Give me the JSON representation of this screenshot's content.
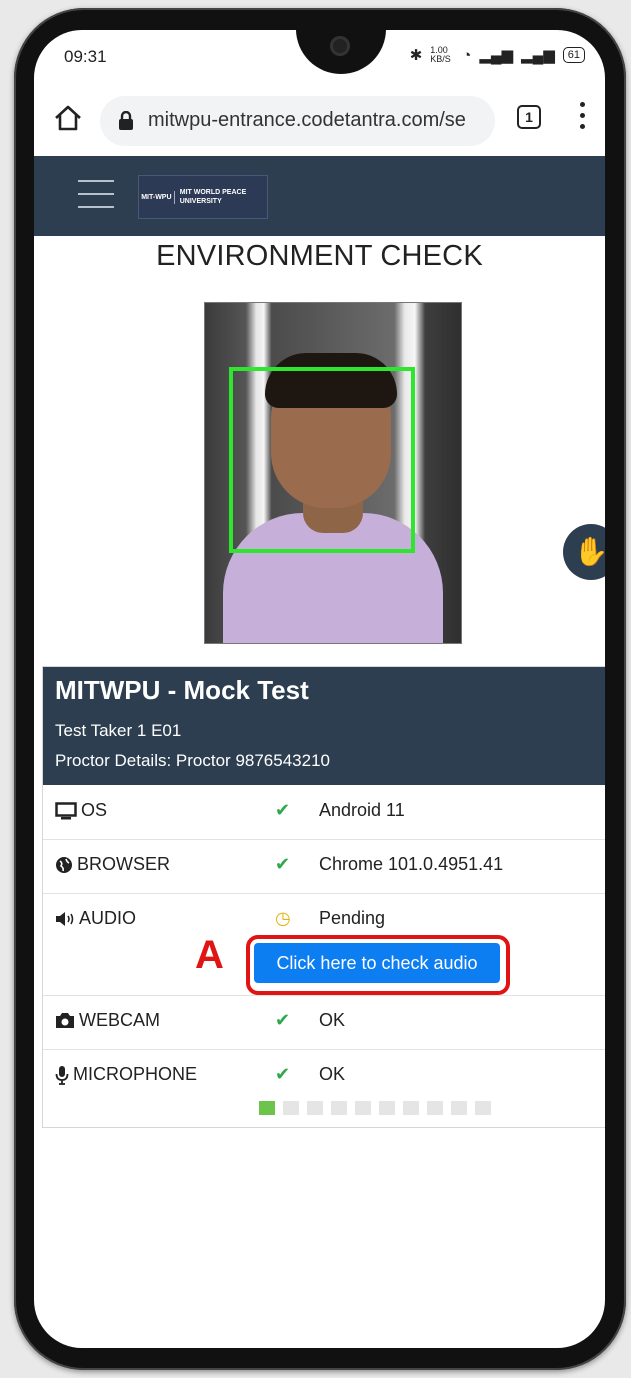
{
  "status_bar": {
    "time": "09:31",
    "network_speed": "1.00 KB/S",
    "battery": "61"
  },
  "browser": {
    "url": "mitwpu-entrance.codetantra.com/se",
    "tab_count": "1"
  },
  "site": {
    "logo_left": "MIT-WPU",
    "logo_right": "MIT WORLD PEACE UNIVERSITY"
  },
  "page": {
    "title": "ENVIRONMENT CHECK"
  },
  "exam": {
    "title": "MITWPU - Mock Test",
    "test_taker": "Test Taker 1 E01",
    "proctor": "Proctor Details: Proctor 9876543210"
  },
  "checks": [
    {
      "label": "OS",
      "icon": "monitor-icon",
      "status": "ok",
      "value": "Android 11"
    },
    {
      "label": "BROWSER",
      "icon": "globe-icon",
      "status": "ok",
      "value": "Chrome 101.0.4951.41"
    },
    {
      "label": "AUDIO",
      "icon": "speaker-icon",
      "status": "pending",
      "value": "Pending",
      "button_label": "Click here to check audio"
    },
    {
      "label": "WEBCAM",
      "icon": "camera-icon",
      "status": "ok",
      "value": "OK"
    },
    {
      "label": "MICROPHONE",
      "icon": "microphone-icon",
      "status": "ok",
      "value": "OK",
      "level_segments": 10,
      "level_active": 1
    }
  ],
  "annotation": {
    "marker": "A"
  },
  "colors": {
    "header_bg": "#2c3e50",
    "ok": "#2ea84a",
    "pending": "#e3b20c",
    "button": "#0d7df2",
    "highlight": "#e11414",
    "face_box": "#2ee62e"
  }
}
